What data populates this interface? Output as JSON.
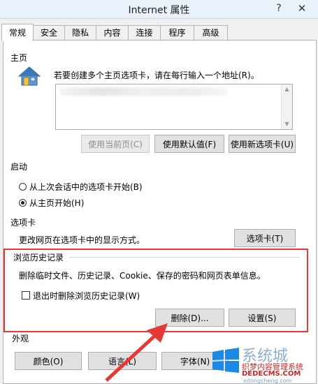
{
  "window": {
    "title": "Internet 属性",
    "help_glyph": "?",
    "close_glyph": "✕"
  },
  "tabs": [
    {
      "label": "常规",
      "active": true
    },
    {
      "label": "安全",
      "active": false
    },
    {
      "label": "隐私",
      "active": false
    },
    {
      "label": "内容",
      "active": false
    },
    {
      "label": "连接",
      "active": false
    },
    {
      "label": "程序",
      "active": false
    },
    {
      "label": "高级",
      "active": false
    }
  ],
  "homepage": {
    "section_label": "主页",
    "instruction": "若要创建多个主页选项卡，请在每行输入一个地址(R)。",
    "url_value": "",
    "buttons": {
      "use_current": "使用当前页(C)",
      "use_default": "使用默认值(F)",
      "use_new_tab": "使用新选项卡(U)"
    }
  },
  "startup": {
    "section_label": "启动",
    "options": [
      {
        "label": "从上次会话中的选项卡开始(B)",
        "checked": false
      },
      {
        "label": "从主页开始(H)",
        "checked": true
      }
    ]
  },
  "tabs_section": {
    "section_label": "选项卡",
    "description": "更改网页在选项卡中的显示方式。",
    "button": "选项卡(T)"
  },
  "history": {
    "section_label": "浏览历史记录",
    "description": "删除临时文件、历史记录、Cookie、保存的密码和网页表单信息。",
    "checkbox_label": "退出时删除浏览历史记录(W)",
    "checkbox_checked": false,
    "delete_button": "删除(D)...",
    "settings_button": "设置(S)"
  },
  "appearance": {
    "section_label": "外观",
    "buttons": {
      "colors": "颜色(O)",
      "languages": "语言(L)",
      "fonts": "字体(N)"
    }
  },
  "watermark": {
    "brand": "系统城",
    "line1": "织梦内容管理系统",
    "line2": "DEDECMS.COM",
    "line3": "xitongcheng.com"
  },
  "colors": {
    "highlight": "#e53935",
    "arrow": "#e53935"
  }
}
